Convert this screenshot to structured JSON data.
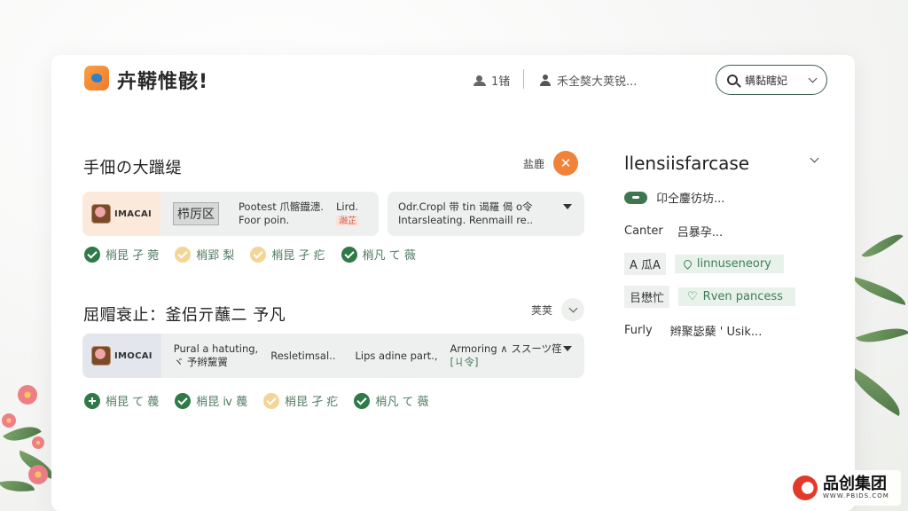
{
  "header": {
    "app_title": "卉鞯惟骸!",
    "users_count": "1锗",
    "account_label": "禾全獒大荚锐...",
    "search_label": "螨黏瞎妃"
  },
  "section1": {
    "title": "手佃の大躐缇",
    "action_label": "盐鹿",
    "close_symbol": "✕",
    "card_a": {
      "thumb_text": "IMACAI",
      "tag": "栉厉区",
      "line1": "Pootest 爪髂鐡漶.",
      "line2": "Foor poin.",
      "side1": "Lird.",
      "side2": "瀜芷"
    },
    "card_b": {
      "line1": "Odr.Cropl 带 tin 谒羅 偈 o令",
      "line2": "Intarsleating.     Renmaill re.."
    },
    "pills": [
      {
        "label": "梢昆 孑 菀",
        "style": "check"
      },
      {
        "label": "梢郢 梨",
        "style": "pale"
      },
      {
        "label": "梢昆 孑 疕",
        "style": "pale"
      },
      {
        "label": "梢凡 て 薇",
        "style": "check"
      }
    ]
  },
  "section2": {
    "title": "屈赗衰止：釜侣亓蘸二 予凡",
    "action_label": "荚荚",
    "card": {
      "thumb_text": "IMOCAI",
      "line1": "Pural a hatuting,",
      "line2": "ヾ 予辫黧黉",
      "mid": "Resletimsal..",
      "side": "Lips adine part.,",
      "right1": "Armoring ∧ ススーツ䇮",
      "right2": "[ㄐ令]"
    },
    "pills": [
      {
        "label": "梢昆 て 薎",
        "style": "plus"
      },
      {
        "label": "梢昆 ⅳ 薎",
        "style": "check"
      },
      {
        "label": "梢昆 孑 疕",
        "style": "pale"
      },
      {
        "label": "梢凡 て 薇",
        "style": "check"
      }
    ]
  },
  "right_panel": {
    "title": "llensiisfarcase",
    "row1_text": "卬仝鏖彷坊...",
    "row2_label": "Canter",
    "row2_value": "吕暴孕...",
    "row3_label": "A 瓜A",
    "row3_chip": "linnuseneory",
    "row4_label": "㠯懋忙",
    "row4_chip": "Rven pancess",
    "row5_label": "Furly",
    "row5_value": "辫聚毖蘖 ' Usik..."
  },
  "watermark": {
    "name": "品创集团",
    "url": "WWW.PBIDS.COM"
  },
  "colors": {
    "accent_orange": "#f0823a",
    "accent_green": "#2f7a48",
    "chip_bg": "#e8f2ea"
  }
}
